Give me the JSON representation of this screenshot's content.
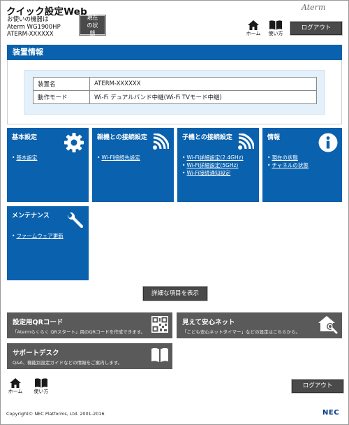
{
  "header": {
    "title": "クイック設定Web",
    "device_label": "お使いの機器は",
    "model": "Aterm WG1900HP",
    "device_name": "ATERM-XXXXXX",
    "status_button": "現在の状態",
    "brand": "Aterm",
    "home_label": "ホーム",
    "howto_label": "使い方",
    "logout_label": "ログアウト"
  },
  "device_info": {
    "title": "装置情報",
    "rows": [
      {
        "key": "装置名",
        "value": "ATERM-XXXXXX"
      },
      {
        "key": "動作モード",
        "value": "Wi-Fi デュアルバンド中継(Wi-Fi TVモード中継)"
      }
    ]
  },
  "tiles": [
    {
      "title": "基本設定",
      "icon": "gear-icon",
      "links": [
        "基本設定"
      ]
    },
    {
      "title": "親機との接続設定",
      "icon": "wifi-icon",
      "links": [
        "Wi-Fi接続先設定"
      ]
    },
    {
      "title": "子機との接続設定",
      "icon": "wifi-icon",
      "links": [
        "Wi-Fi詳細設定(2.4GHz)",
        "Wi-Fi詳細設定(5GHz)",
        "Wi-Fi接続通知設定"
      ]
    },
    {
      "title": "情報",
      "icon": "info-icon",
      "links": [
        "現在の状態",
        "チャネルの状態"
      ]
    },
    {
      "title": "メンテナンス",
      "icon": "wrench-icon",
      "links": [
        "ファームウェア更新"
      ]
    }
  ],
  "detail_button": "詳細な項目を表示",
  "cards": [
    {
      "title": "設定用QRコード",
      "desc": "「Atermらくらく QRスタート」用のQRコードを作成できます。",
      "icon": "qr-code-icon"
    },
    {
      "title": "見えて安心ネット",
      "desc": "「こども安心ネットタイマー」などの設定はこちらから。",
      "icon": "house-search-icon"
    },
    {
      "title": "サポートデスク",
      "desc": "Q&A、機能別設定ガイドなどの情報をご案内します。",
      "icon": "book-icon"
    }
  ],
  "footer": {
    "home_label": "ホーム",
    "howto_label": "使い方",
    "logout_label": "ログアウト",
    "copyright": "Copyright© NEC Platforms, Ltd. 2001-2016",
    "logo": "NEC"
  },
  "colors": {
    "accent": "#0a61ad",
    "button": "#4a4a4a",
    "card": "#5a5a5a",
    "info_bg": "#e4f0fa"
  }
}
